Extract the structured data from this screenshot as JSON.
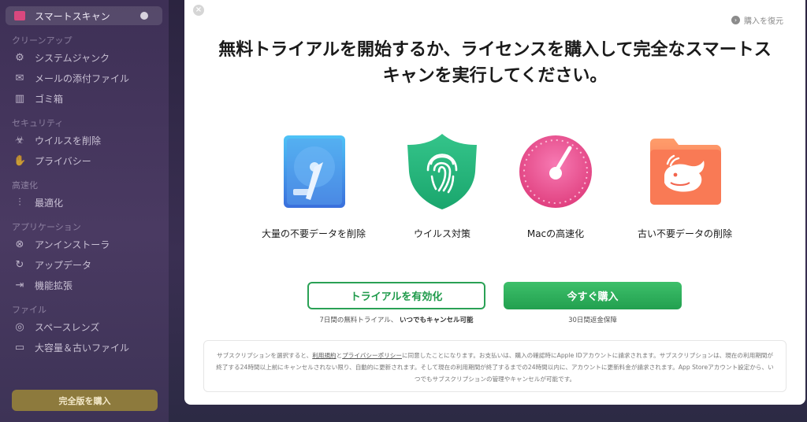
{
  "sidebar": {
    "active_item": {
      "label": "スマートスキャン"
    },
    "sections": [
      {
        "header": "クリーンアップ",
        "items": [
          {
            "label": "システムジャンク",
            "icon": "system-junk-icon"
          },
          {
            "label": "メールの添付ファイル",
            "icon": "mail-icon"
          },
          {
            "label": "ゴミ箱",
            "icon": "trash-icon"
          }
        ]
      },
      {
        "header": "セキュリティ",
        "items": [
          {
            "label": "ウイルスを削除",
            "icon": "biohazard-icon"
          },
          {
            "label": "プライバシー",
            "icon": "hand-icon"
          }
        ]
      },
      {
        "header": "高速化",
        "items": [
          {
            "label": "最適化",
            "icon": "sliders-icon"
          }
        ]
      },
      {
        "header": "アプリケーション",
        "items": [
          {
            "label": "アンインストーラ",
            "icon": "uninstaller-icon"
          },
          {
            "label": "アップデータ",
            "icon": "updater-icon"
          },
          {
            "label": "機能拡張",
            "icon": "extensions-icon"
          }
        ]
      },
      {
        "header": "ファイル",
        "items": [
          {
            "label": "スペースレンズ",
            "icon": "space-lens-icon"
          },
          {
            "label": "大容量＆古いファイル",
            "icon": "folder-icon"
          }
        ]
      }
    ],
    "buy_full_label": "完全版を購入"
  },
  "modal": {
    "restore_label": "購入を復元",
    "headline": "無料トライアルを開始するか、ライセンスを購入して完全なスマートスキャンを実行してください。",
    "features": [
      {
        "label": "大量の不要データを削除",
        "icon": "hard-drive-icon"
      },
      {
        "label": "ウイルス対策",
        "icon": "fingerprint-shield-icon"
      },
      {
        "label": "Macの高速化",
        "icon": "speedometer-icon"
      },
      {
        "label": "古い不要データの削除",
        "icon": "whale-folder-icon"
      }
    ],
    "trial_button": "トライアルを有効化",
    "buy_button": "今すぐ購入",
    "trial_note_prefix": "7日間の無料トライアル、",
    "trial_note_bold": "いつでもキャンセル可能",
    "buy_note": "30日間返金保障",
    "terms": {
      "part1": "サブスクリプションを選択すると、",
      "link1": "利用規約",
      "part2": "と",
      "link2": "プライバシーポリシー",
      "part3": "に同意したことになります。お支払いは、購入の確認時にApple IDアカウントに請求されます。サブスクリプションは、現在の利用期間が終了する24時間以上前にキャンセルされない限り、自動的に更新されます。そして現在の利用期間が終了するまでの24時間以内に、アカウントに更新料金が請求されます。App Storeアカウント設定から、いつでもサブスクリプションの管理やキャンセルが可能です。"
    }
  },
  "colors": {
    "accent_green": "#2aa155",
    "sidebar_bg": "#45375c",
    "buy_full_bg": "#8d7a3d"
  }
}
